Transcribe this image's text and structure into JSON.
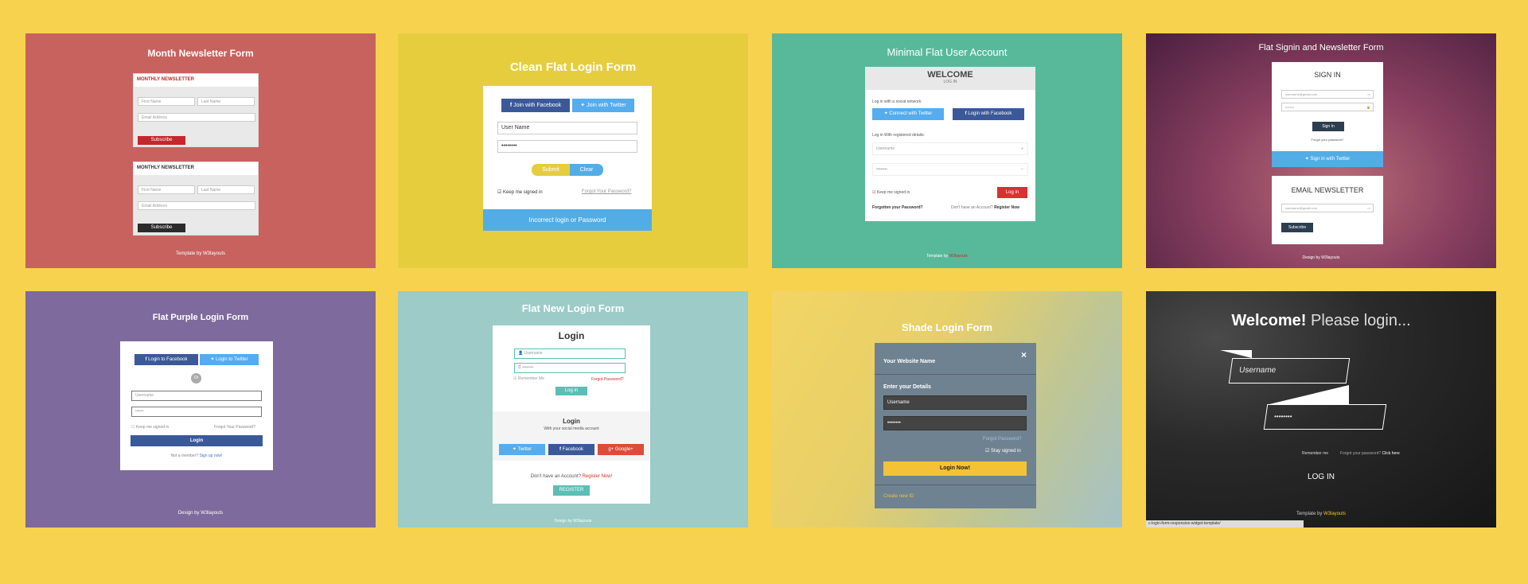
{
  "cards": [
    {
      "title": "Month Newsletter Form",
      "heading": "MONTHLY NEWSLETTER",
      "first_name": "First Name",
      "last_name": "Last Name",
      "email": "Email Address",
      "subscribe": "Subscribe",
      "footer": "Template by W3layouts",
      "bg": "#c8625e"
    },
    {
      "title": "Clean Flat Login Form",
      "facebook": "Join with Facebook",
      "twitter": "Join with Twitter",
      "username": "User Name",
      "password": "••••••••",
      "submit": "Submit",
      "clear": "Clear",
      "keep": "Keep me signed in",
      "forgot": "Forgot Your Password?",
      "error": "Incorrect login or Password",
      "bg": "#e6cd3e"
    },
    {
      "title": "Minimal Flat User Account",
      "welcome": "WELCOME",
      "login": "LOG IN",
      "social_label": "Log in with a social network:",
      "twitter": "Connect with Twitter",
      "facebook": "Login with Facebook",
      "registered_label": "Log in With registered details:",
      "username": "Username",
      "password": "••••••••",
      "keep": "Keep me signed in",
      "login_btn": "Log in",
      "forgot": "Forgotten your Password?",
      "no_account": "Don't have an Account?",
      "register": "Register Now",
      "footer": "Template by",
      "footer_brand": "W3layouts",
      "bg": "#58b99a"
    },
    {
      "title": "Flat Signin and Newsletter Form",
      "signin": "SIGN IN",
      "email": "username@gmail.com",
      "password": "••••••••",
      "signin_btn": "Sign In",
      "forgot": "Forgot your password?",
      "twitter": "Sign in with Twitter",
      "newsletter": "EMAIL NEWSLETTER",
      "news_email": "username@gmail.com",
      "subscribe": "Subscribe",
      "footer": "Design by W3layouts"
    },
    {
      "title": "Flat Purple Login Form",
      "facebook": "Login to Facebook",
      "twitter": "Login to Twitter",
      "or": "Or",
      "username": "Username",
      "password": "••••••",
      "keep": "Keep me signed in",
      "forgot": "Forgot Your Password?",
      "login": "Login",
      "not_member": "Not a member?",
      "signup": "Sign up now!",
      "footer": "Design by W3layouts",
      "bg": "#7e6a9c"
    },
    {
      "title": "Flat New Login Form",
      "login": "Login",
      "username": "Username",
      "password": "••••••••",
      "remember": "Remember Me",
      "forgot": "Forgot Password?",
      "login_btn": "Log in",
      "social_title": "Login",
      "social_sub": "With your social media account",
      "twitter": "Twitter",
      "facebook": "Facebook",
      "google": "Google+",
      "no_account": "Don't have an Account?",
      "register_now": "Register Now!",
      "register": "REGISTER",
      "footer": "Design by W3layouts",
      "bg": "#9ccbc8"
    },
    {
      "title": "Shade Login Form",
      "site": "Your Website Name",
      "close": "×",
      "details": "Enter your Details",
      "username": "Username",
      "password": "••••••••",
      "forgot": "Forgot Password?",
      "stay": "Stay signed in",
      "login": "Login Now!",
      "create": "Create new ID"
    },
    {
      "title_bold": "Welcome!",
      "title_rest": "Please login...",
      "username": "Username",
      "password": "••••••••",
      "remember": "Remember me",
      "forgot": "Forgot your password?",
      "click": "Click here",
      "login": "LOG IN",
      "footer": "Template by",
      "footer_brand": "W3layouts",
      "url": "c-login-form-responsive-widget-template/"
    }
  ]
}
